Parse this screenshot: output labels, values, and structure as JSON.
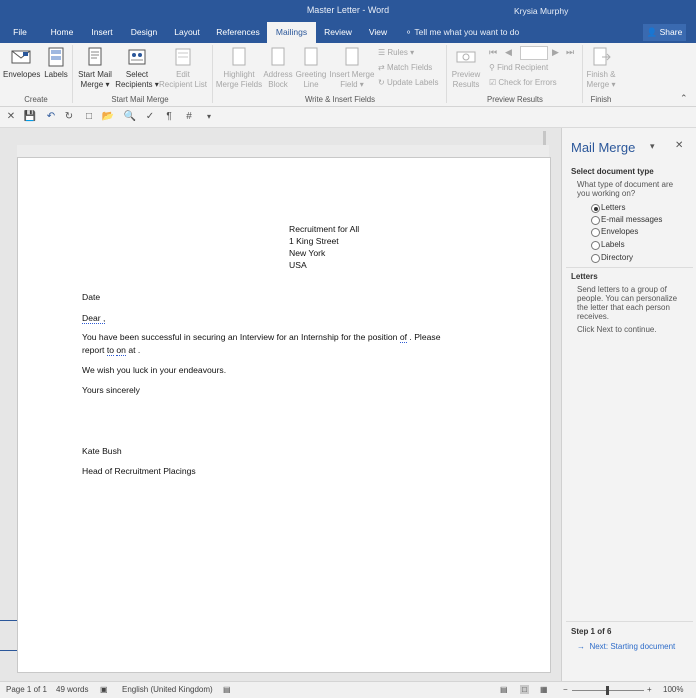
{
  "window": {
    "title": "Master Letter - Word",
    "user": "Krysia Murphy"
  },
  "tabs": [
    "File",
    "Home",
    "Insert",
    "Design",
    "Layout",
    "References",
    "Mailings",
    "Review",
    "View"
  ],
  "active_tab": "Mailings",
  "tell_me": "Tell me what you want to do",
  "share_label": "Share",
  "ribbon": {
    "create": {
      "envelopes": "Envelopes",
      "labels": "Labels",
      "group": "Create"
    },
    "start": {
      "start_merge_1": "Start Mail",
      "start_merge_2": "Merge",
      "select_1": "Select",
      "select_2": "Recipients",
      "edit_1": "Edit",
      "edit_2": "Recipient List",
      "group": "Start Mail Merge"
    },
    "write": {
      "highlight_1": "Highlight",
      "highlight_2": "Merge Fields",
      "address_1": "Address",
      "address_2": "Block",
      "greeting_1": "Greeting",
      "greeting_2": "Line",
      "insert_1": "Insert Merge",
      "insert_2": "Field",
      "rules": "Rules",
      "match": "Match Fields",
      "update": "Update Labels",
      "group": "Write & Insert Fields"
    },
    "preview": {
      "preview_1": "Preview",
      "preview_2": "Results",
      "find": "Find Recipient",
      "check": "Check for Errors",
      "group": "Preview Results"
    },
    "finish": {
      "finish_1": "Finish &",
      "finish_2": "Merge",
      "group": "Finish"
    }
  },
  "document": {
    "address": [
      "Recruitment for All",
      "1 King Street",
      "New York",
      "USA"
    ],
    "date": "Date",
    "dear": "Dear ,",
    "p1_a": "You have been successful in securing an Interview for an Internship for the position",
    "p1_of": "of",
    "p1_b": ". Please",
    "p2_a": "report",
    "p2_to": "to",
    "p2_on": "on",
    "p2_at": "at",
    "p2_end": ".",
    "p3": "We wish you luck in your endeavours.",
    "p4": "Yours sincerely",
    "name": "Kate Bush",
    "role": "Head of Recruitment Placings"
  },
  "pane": {
    "title": "Mail Merge",
    "section1": "Select document type",
    "question_1": "What type of document are",
    "question_2": "you working on?",
    "options": [
      "Letters",
      "E-mail messages",
      "Envelopes",
      "Labels",
      "Directory"
    ],
    "selected": "Letters",
    "section2": "Letters",
    "desc_1": "Send letters to a group of",
    "desc_2": "people. You can personalize",
    "desc_3": "the letter that each person",
    "desc_4": "receives.",
    "next_hint": "Click Next to continue.",
    "step": "Step 1 of 6",
    "next_link": "Next: Starting document"
  },
  "status": {
    "page": "Page 1 of 1",
    "words": "49 words",
    "language": "English (United Kingdom)",
    "zoom": "100%"
  },
  "colors": {
    "brand": "#2b579a",
    "link": "#2e6cc9"
  }
}
